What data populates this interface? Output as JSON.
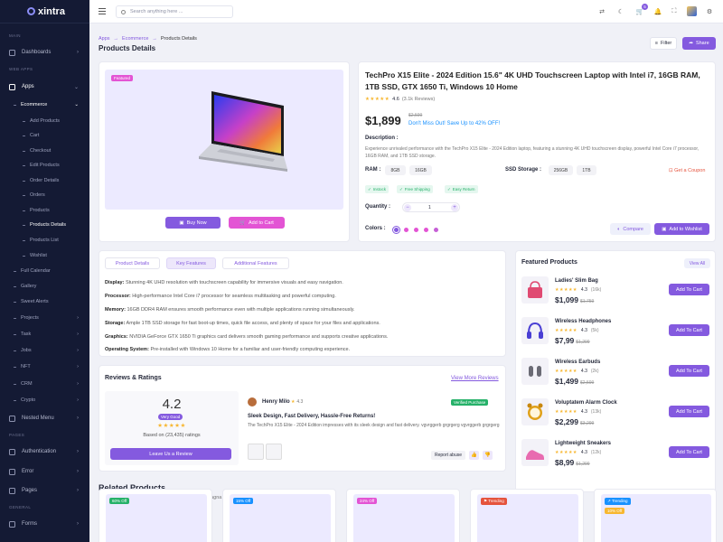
{
  "app": {
    "name": "xintra"
  },
  "topbar": {
    "search_placeholder": "Search anything here ...",
    "cart_count": "5"
  },
  "sidebar": {
    "sections": {
      "main": "MAIN",
      "web_apps": "WEB APPS",
      "pages": "PAGES",
      "general": "GENERAL"
    },
    "items": {
      "dashboards": "Dashboards",
      "apps": "Apps",
      "ecommerce": "Ecommerce",
      "add_products": "Add Products",
      "cart": "Cart",
      "checkout": "Checkout",
      "edit_products": "Edit Products",
      "order_details": "Order Details",
      "orders": "Orders",
      "products": "Products",
      "products_details": "Products Details",
      "products_list": "Products List",
      "wishlist": "Wishlist",
      "full_calendar": "Full Calendar",
      "gallery": "Gallery",
      "sweet_alerts": "Sweet Alerts",
      "projects": "Projects",
      "task": "Task",
      "jobs": "Jobs",
      "nft": "NFT",
      "crm": "CRM",
      "crypto": "Crypto",
      "nested_menu": "Nested Menu",
      "authentication": "Authentication",
      "error": "Error",
      "pages": "Pages",
      "forms": "Forms"
    }
  },
  "breadcrumb": {
    "apps": "Apps",
    "ecommerce": "Ecommerce",
    "current": "Products Details",
    "sep": "→"
  },
  "header": {
    "title": "Products Details",
    "filter": "Filter",
    "share": "Share"
  },
  "product": {
    "featured": "Featured",
    "title": "TechPro X15 Elite - 2024 Edition 15.6\" 4K UHD Touchscreen Laptop with Intel i7, 16GB RAM, 1TB SSD, GTX 1650 Ti, Windows 10 Home",
    "stars": "★★★★★",
    "rating": "4.6",
    "reviews": "(3.1k Reviews)",
    "price": "$1,899",
    "old_price": "$2,599",
    "save_text": "Don't Miss Out! Save Up to 42% OFF!",
    "description_label": "Description :",
    "description": "Experience unrivaled performance with the TechPro X15 Elite - 2024 Edition laptop, featuring a stunning 4K UHD touchscreen display, powerful Intel Core i7 processor, 16GB RAM, and 1TB SSD storage.",
    "ram_label": "RAM :",
    "ram_options": [
      "8GB",
      "16GB"
    ],
    "ssd_label": "SSD Storage :",
    "ssd_options": [
      "256GB",
      "1TB"
    ],
    "coupon": "Get a Coupon",
    "tags": [
      "Instock",
      "Free Shipping",
      "Easy Return"
    ],
    "quantity_label": "Quantity :",
    "quantity": "1",
    "colors_label": "Colors :",
    "colors": [
      "#845adf",
      "#e354d4",
      "#e354d4",
      "#e354d4",
      "#c65fd6"
    ],
    "buy_now": "Buy Now",
    "add_to_cart": "Add to Cart",
    "compare": "Compare",
    "add_to_wishlist": "Add to Wishlist"
  },
  "features": {
    "tabs": [
      "Product Details",
      "Key Features",
      "Additional Features"
    ],
    "active_tab": 1,
    "lines": [
      {
        "label": "Display:",
        "text": "Stunning 4K UHD resolution with touchscreen capability for immersive visuals and easy navigation."
      },
      {
        "label": "Processor:",
        "text": "High-performance Intel Core i7 processor for seamless multitasking and powerful computing."
      },
      {
        "label": "Memory:",
        "text": "16GB DDR4 RAM ensures smooth performance even with multiple applications running simultaneously."
      },
      {
        "label": "Storage:",
        "text": "Ample 1TB SSD storage for fast boot-up times, quick file access, and plenty of space for your files and applications."
      },
      {
        "label": "Graphics:",
        "text": "NVIDIA GeForce GTX 1650 Ti graphics card delivers smooth gaming performance and supports creative applications."
      },
      {
        "label": "Operating System:",
        "text": "Pre-installed with Windows 10 Home for a familiar and user-friendly computing experience."
      }
    ]
  },
  "reviews": {
    "title": "Reviews & Ratings",
    "view_more": "View More Reviews",
    "score": "4.2",
    "score_label": "Very Good",
    "stars": "★★★★★",
    "based_on": "Based on (23,435) ratings",
    "leave_review": "Leave Us a Review",
    "item": {
      "name": "Henry Milo",
      "score": "4.3",
      "verified": "Verified Purchase",
      "headline": "Sleek Design, Fast Delivery, Hassle-Free Returns!",
      "body": "The TechPro X15 Elite - 2024 Edition impresses with its sleek design and fast delivery. vgvrggerb grgrgerg vgvrggerb grgrgerg",
      "report": "Report abuse"
    }
  },
  "featured_products": {
    "title": "Featured Products",
    "view_all": "View All",
    "add_label": "Add To Cart",
    "items": [
      {
        "name": "Ladies' Slim Bag",
        "rating": "4.3",
        "count": "(16k)",
        "price": "$1,099",
        "old": "$1,759",
        "color": "#e04a72"
      },
      {
        "name": "Wireless Headphones",
        "rating": "4.3",
        "count": "(5k)",
        "price": "$7,99",
        "old": "$1,299",
        "color": "#4a3fd4"
      },
      {
        "name": "Wireless Earbuds",
        "rating": "4.3",
        "count": "(2k)",
        "price": "$1,499",
        "old": "$2,599",
        "color": "#6b6b75"
      },
      {
        "name": "Voluptatem Alarm Clock",
        "rating": "4.3",
        "count": "(13k)",
        "price": "$2,299",
        "old": "$3,299",
        "color": "#e0a11a"
      },
      {
        "name": "Lightweight Sneakers",
        "rating": "4.3",
        "count": "(12k)",
        "price": "$8,99",
        "old": "$1,299",
        "color": "#e86bb0"
      }
    ]
  },
  "related": {
    "title": "Related Products",
    "subtitle": "Explore more products similar to this one, dolore magna aliqua.",
    "badges": [
      {
        "label": "60% Off",
        "color": "#26b169"
      },
      {
        "label": "15% Off",
        "color": "#1891ff"
      },
      {
        "label": "24% Off",
        "color": "#e354d4"
      },
      {
        "label": "Trending",
        "color": "#e5533d"
      },
      {
        "label": "Trending",
        "color": "#1891ff"
      }
    ],
    "extra_badge": "10% Off"
  }
}
